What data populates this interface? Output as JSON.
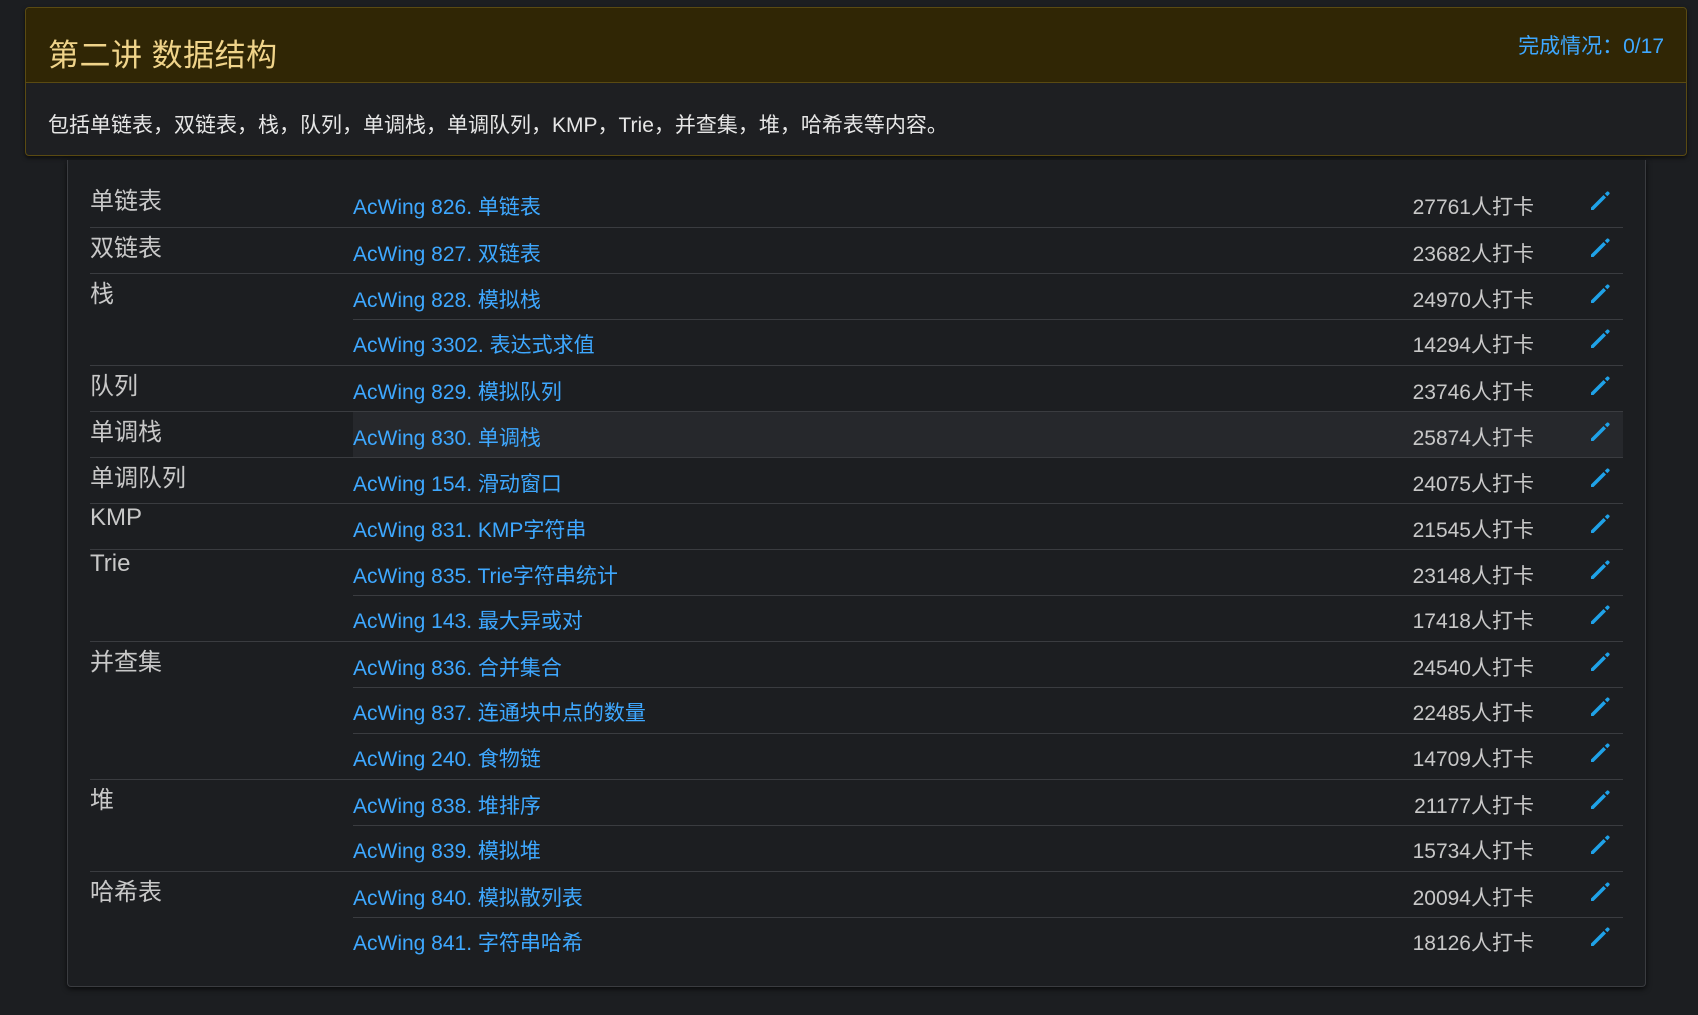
{
  "header": {
    "title": "第二讲 数据结构",
    "progress": "完成情况：0/17",
    "description": "包括单链表，双链表，栈，队列，单调栈，单调队列，KMP，Trie，并查集，堆，哈希表等内容。"
  },
  "colors": {
    "accent": "#3ea8ff",
    "heading_bg": "#302605",
    "title_text": "#f0d48a",
    "edit_icon": "#1fa2e8"
  },
  "rows": [
    {
      "category": "单链表",
      "problem": "AcWing 826. 单链表",
      "count": "27761人打卡",
      "icon": "pencil-icon"
    },
    {
      "category": "双链表",
      "problem": "AcWing 827. 双链表",
      "count": "23682人打卡",
      "icon": "pencil-icon"
    },
    {
      "category": "栈",
      "problem": "AcWing 828. 模拟栈",
      "count": "24970人打卡",
      "icon": "pencil-icon"
    },
    {
      "category": "",
      "problem": "AcWing 3302. 表达式求值",
      "count": "14294人打卡",
      "icon": "pencil-icon"
    },
    {
      "category": "队列",
      "problem": "AcWing 829. 模拟队列",
      "count": "23746人打卡",
      "icon": "pencil-icon"
    },
    {
      "category": "单调栈",
      "problem": "AcWing 830. 单调栈",
      "count": "25874人打卡",
      "icon": "pencil-icon"
    },
    {
      "category": "单调队列",
      "problem": "AcWing 154. 滑动窗口",
      "count": "24075人打卡",
      "icon": "pencil-icon"
    },
    {
      "category": "KMP",
      "problem": "AcWing 831. KMP字符串",
      "count": "21545人打卡",
      "icon": "pencil-icon"
    },
    {
      "category": "Trie",
      "problem": "AcWing 835. Trie字符串统计",
      "count": "23148人打卡",
      "icon": "pencil-icon"
    },
    {
      "category": "",
      "problem": "AcWing 143. 最大异或对",
      "count": "17418人打卡",
      "icon": "pencil-icon"
    },
    {
      "category": "并查集",
      "problem": "AcWing 836. 合并集合",
      "count": "24540人打卡",
      "icon": "pencil-icon"
    },
    {
      "category": "",
      "problem": "AcWing 837. 连通块中点的数量",
      "count": "22485人打卡",
      "icon": "pencil-icon"
    },
    {
      "category": "",
      "problem": "AcWing 240. 食物链",
      "count": "14709人打卡",
      "icon": "pencil-icon"
    },
    {
      "category": "堆",
      "problem": "AcWing 838. 堆排序",
      "count": "21177人打卡",
      "icon": "pencil-icon"
    },
    {
      "category": "",
      "problem": "AcWing 839. 模拟堆",
      "count": "15734人打卡",
      "icon": "pencil-icon"
    },
    {
      "category": "哈希表",
      "problem": "AcWing 840. 模拟散列表",
      "count": "20094人打卡",
      "icon": "pencil-icon"
    },
    {
      "category": "",
      "problem": "AcWing 841. 字符串哈希",
      "count": "18126人打卡",
      "icon": "pencil-icon"
    }
  ]
}
